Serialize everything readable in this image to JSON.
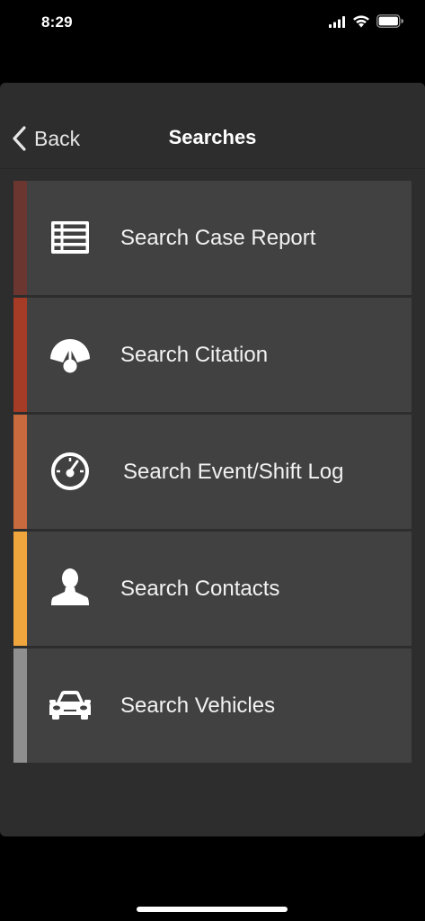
{
  "status_bar": {
    "time": "8:29"
  },
  "nav": {
    "back_label": "Back",
    "title": "Searches"
  },
  "menu": [
    {
      "label": "Search Case Report",
      "icon": "report-list-icon",
      "accent": "#6b3530"
    },
    {
      "label": "Search Citation",
      "icon": "citation-gauge-icon",
      "accent": "#a63b26"
    },
    {
      "label": "Search Event/Shift Log",
      "icon": "clock-gauge-icon",
      "accent": "#c96a3e"
    },
    {
      "label": "Search Contacts",
      "icon": "person-icon",
      "accent": "#f0a63c"
    },
    {
      "label": "Search Vehicles",
      "icon": "car-icon",
      "accent": "#8f8f8f"
    }
  ],
  "colors": {
    "panel_bg": "#2d2d2d",
    "item_bg": "#414141"
  }
}
